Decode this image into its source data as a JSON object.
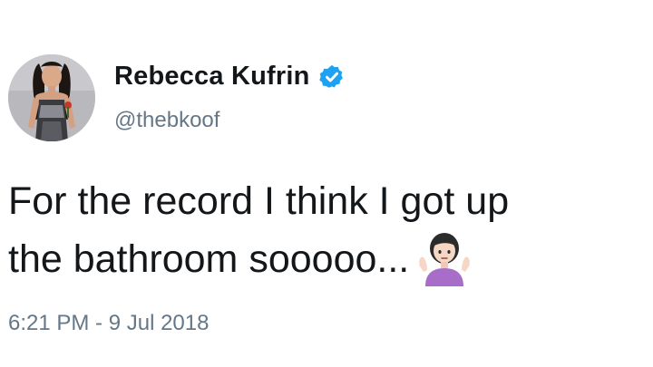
{
  "author": {
    "display_name": "Rebecca Kufrin",
    "handle": "@thebkoof",
    "verified": true,
    "verified_icon": "verified-badge-icon"
  },
  "tweet": {
    "line1": "For the record I think I got up",
    "line2": "the bathroom sooooo...",
    "emoji": "woman-shrugging-emoji",
    "timestamp": "6:21 PM - 9 Jul 2018"
  },
  "colors": {
    "text": "#14171a",
    "secondary": "#657786",
    "verified": "#1da1f2",
    "background": "#ffffff"
  }
}
